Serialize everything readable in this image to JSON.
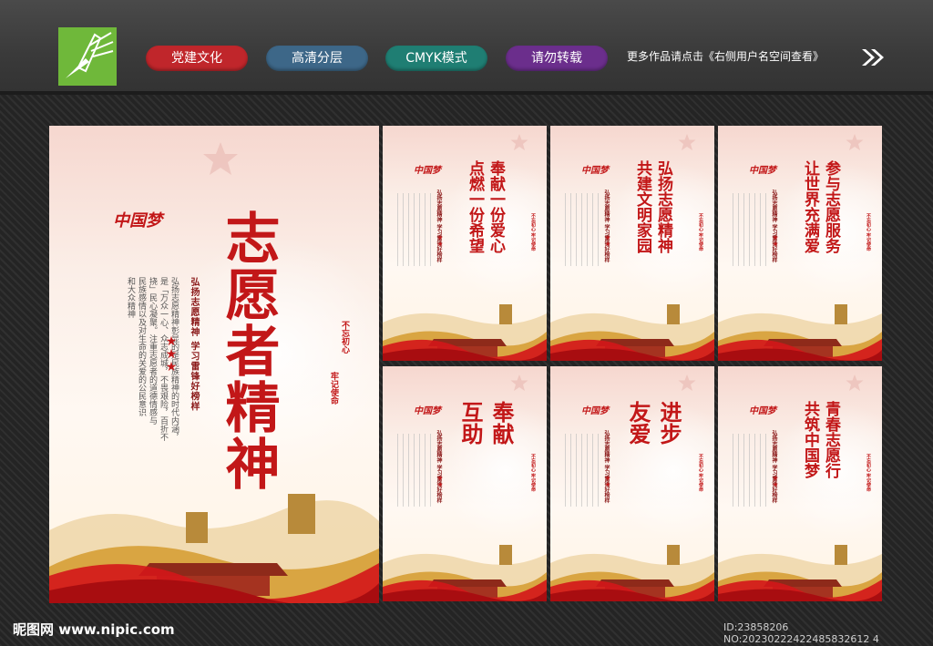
{
  "header": {
    "pills": [
      {
        "label": "党建文化",
        "color": "#c0262b"
      },
      {
        "label": "高清分层",
        "color": "#3d6788"
      },
      {
        "label": "CMYK模式",
        "color": "#1f7e73"
      },
      {
        "label": "请勿转载",
        "color": "#6b2e8c"
      }
    ],
    "more_text": "更多作品请点击《右侧用户名空间查看》"
  },
  "footer": {
    "site": "昵图网 www.nipic.com",
    "id_text": "ID:23858206 NO:20230222422485832612 4"
  },
  "main_poster": {
    "title": "志愿者精神",
    "logo_text": "中国梦",
    "subtitle": "弘扬志愿精神 学习雷锋好榜样",
    "body_lines": [
      "弘扬志愿精神彰显的是民族精神的时代内涵，",
      "是「万众一心、众志成城，不畏艰险，百折不",
      "挠」民心凝聚。注重志愿者的道德情感与",
      "民族感情以及对生命的关爱的公民意识",
      "和大众精神"
    ],
    "seal_lines": [
      "不忘初心",
      "牢记使命"
    ]
  },
  "small_posters": [
    {
      "title_lines": [
        "奉献一份爱心",
        "点燃一份希望"
      ]
    },
    {
      "title_lines": [
        "弘扬志愿精神",
        "共建文明家园"
      ]
    },
    {
      "title_lines": [
        "参与志愿服务",
        "让世界充满爱"
      ]
    },
    {
      "title_lines": [
        "奉献",
        "互助"
      ]
    },
    {
      "title_lines": [
        "进步",
        "友爱"
      ]
    },
    {
      "title_lines": [
        "青春志愿行",
        "共筑中国梦"
      ]
    }
  ],
  "small_common": {
    "subtitle": "弘扬志愿精神 学习雷锋好榜样",
    "seal": "不忘初心 牢记使命",
    "logo_text": "中国梦"
  },
  "icons": [
    "logo-icon",
    "double-arrow-icon",
    "star-icon",
    "great-wall-icon"
  ]
}
